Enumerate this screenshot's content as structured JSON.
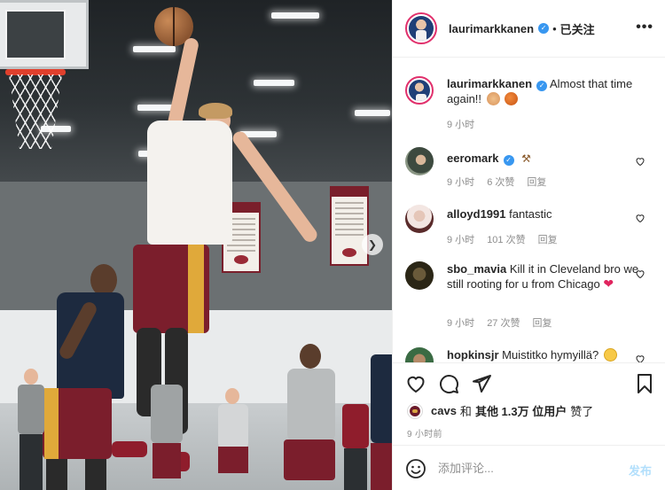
{
  "header": {
    "username": "laurimarkkanen",
    "separator": "•",
    "follow_label": "已关注",
    "more_label": "•••"
  },
  "caption": {
    "username": "laurimarkkanen",
    "text": "Almost that time again!!",
    "time": "9 小时",
    "emojis": [
      "flexed-biceps-emoji",
      "basketball-emoji"
    ]
  },
  "comments": [
    {
      "username": "eeromark",
      "verified": true,
      "text": "",
      "emoji": "hammer-emoji",
      "time": "9 小时",
      "likes": "6 次赞",
      "reply": "回复"
    },
    {
      "username": "alloyd1991",
      "verified": false,
      "text": "fantastic",
      "time": "9 小时",
      "likes": "101 次赞",
      "reply": "回复"
    },
    {
      "username": "sbo_mavia",
      "verified": false,
      "text": "Kill it in Cleveland bro we still rooting for u from Chicago",
      "emoji": "red-heart-emoji",
      "time": "9 小时",
      "likes": "27 次赞",
      "reply": "回复"
    },
    {
      "username": "hopkinsjr",
      "verified": false,
      "text": "Muistitko hymyillä?",
      "emoji": "smiling-face-emoji"
    }
  ],
  "likes_line": {
    "liker": "cavs",
    "connector": "和",
    "others": "其他 1.3万 位用户",
    "suffix": "赞了"
  },
  "post_time": "9 小时前",
  "compose": {
    "placeholder": "添加评论...",
    "post_label": "发布"
  },
  "colors": {
    "verified": "#3897f0",
    "post_button": "#b2dffc",
    "cavs_wine": "#6a1a2a",
    "meta_gray": "#8e8e8e"
  }
}
